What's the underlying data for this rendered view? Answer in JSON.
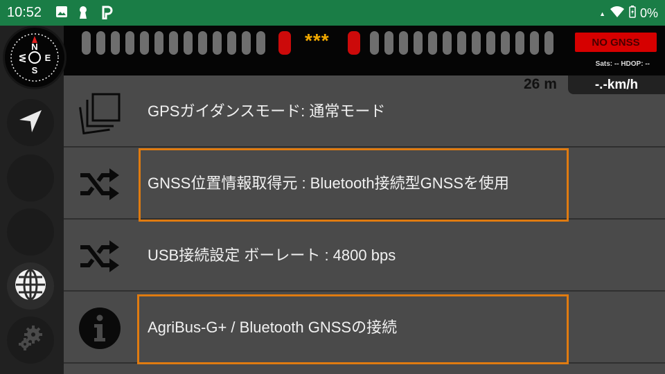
{
  "status_bar": {
    "time": "10:52",
    "left_icons": [
      "image-icon",
      "keyhole-icon",
      "parking-p-icon"
    ],
    "battery": "0%"
  },
  "guidance_bar": {
    "indicator": "***",
    "gnss_status": "NO GNSS",
    "sats": "Sats: --  HDOP: --"
  },
  "metrics": {
    "distance": "26 m",
    "speed": "-.-km/h"
  },
  "sidebar": {
    "items": [
      {
        "name": "compass-icon",
        "letters": [
          "N",
          "E",
          "S",
          "W"
        ]
      },
      {
        "name": "navigation-arrow-icon"
      },
      {
        "name": "empty-slot"
      },
      {
        "name": "empty-slot"
      },
      {
        "name": "globe-icon"
      },
      {
        "name": "gears-icon"
      }
    ]
  },
  "settings": {
    "items": [
      {
        "icon": "pages-icon",
        "label": "GPSガイダンスモード: 通常モード"
      },
      {
        "icon": "shuffle-icon",
        "label": "GNSS位置情報取得元 : Bluetooth接続型GNSSを使用"
      },
      {
        "icon": "shuffle-icon",
        "label": "USB接続設定 ボーレート : 4800 bps"
      },
      {
        "icon": "info-icon",
        "label": "AgriBus-G+ / Bluetooth GNSSの接続"
      }
    ]
  },
  "colors": {
    "status_bar": "#1a7d46",
    "highlight": "#e07b10",
    "no_gnss": "#d60000",
    "stars": "#f0a800"
  }
}
